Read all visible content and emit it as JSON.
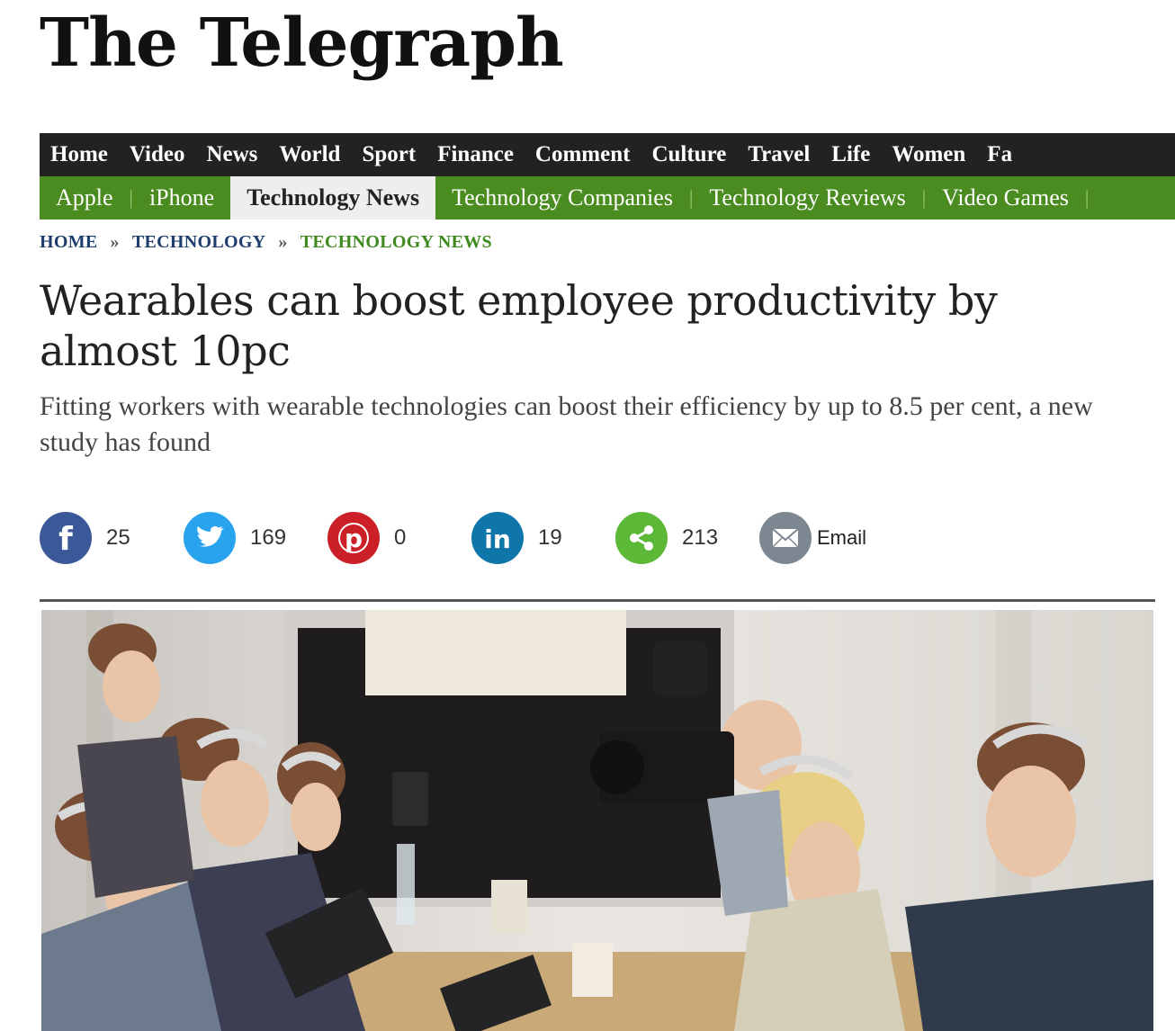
{
  "site": {
    "logo_text": "The Telegraph"
  },
  "main_nav": [
    "Home",
    "Video",
    "News",
    "World",
    "Sport",
    "Finance",
    "Comment",
    "Culture",
    "Travel",
    "Life",
    "Women",
    "Fa"
  ],
  "sub_nav": {
    "items": [
      "Apple",
      "iPhone",
      "Technology News",
      "Technology Companies",
      "Technology Reviews",
      "Video Games"
    ],
    "active": "Technology News"
  },
  "breadcrumb": {
    "home": "Home",
    "section": "Technology",
    "current": "Technology News"
  },
  "article": {
    "headline": "Wearables can boost employee productivity by almost 10pc",
    "standfirst": "Fitting workers with wearable technologies can boost their efficiency by up to 8.5 per cent, a new study has found"
  },
  "share": {
    "facebook": {
      "count": "25",
      "icon": "facebook-icon",
      "color": "#3b5998"
    },
    "twitter": {
      "count": "169",
      "icon": "twitter-icon",
      "color": "#2aa3ef"
    },
    "pinterest": {
      "count": "0",
      "icon": "pinterest-icon",
      "color": "#cb2027"
    },
    "linkedin": {
      "count": "19",
      "icon": "linkedin-icon",
      "color": "#0e76a8"
    },
    "share": {
      "count": "213",
      "icon": "share-icon",
      "color": "#5cb837"
    },
    "email": {
      "label": "Email",
      "icon": "email-icon",
      "color": "#7d8791"
    }
  },
  "colors": {
    "nav_bg": "#222222",
    "subnav_bg": "#4a8c1f",
    "crumb_blue": "#1e3e6e",
    "crumb_green": "#3f8a1f"
  }
}
